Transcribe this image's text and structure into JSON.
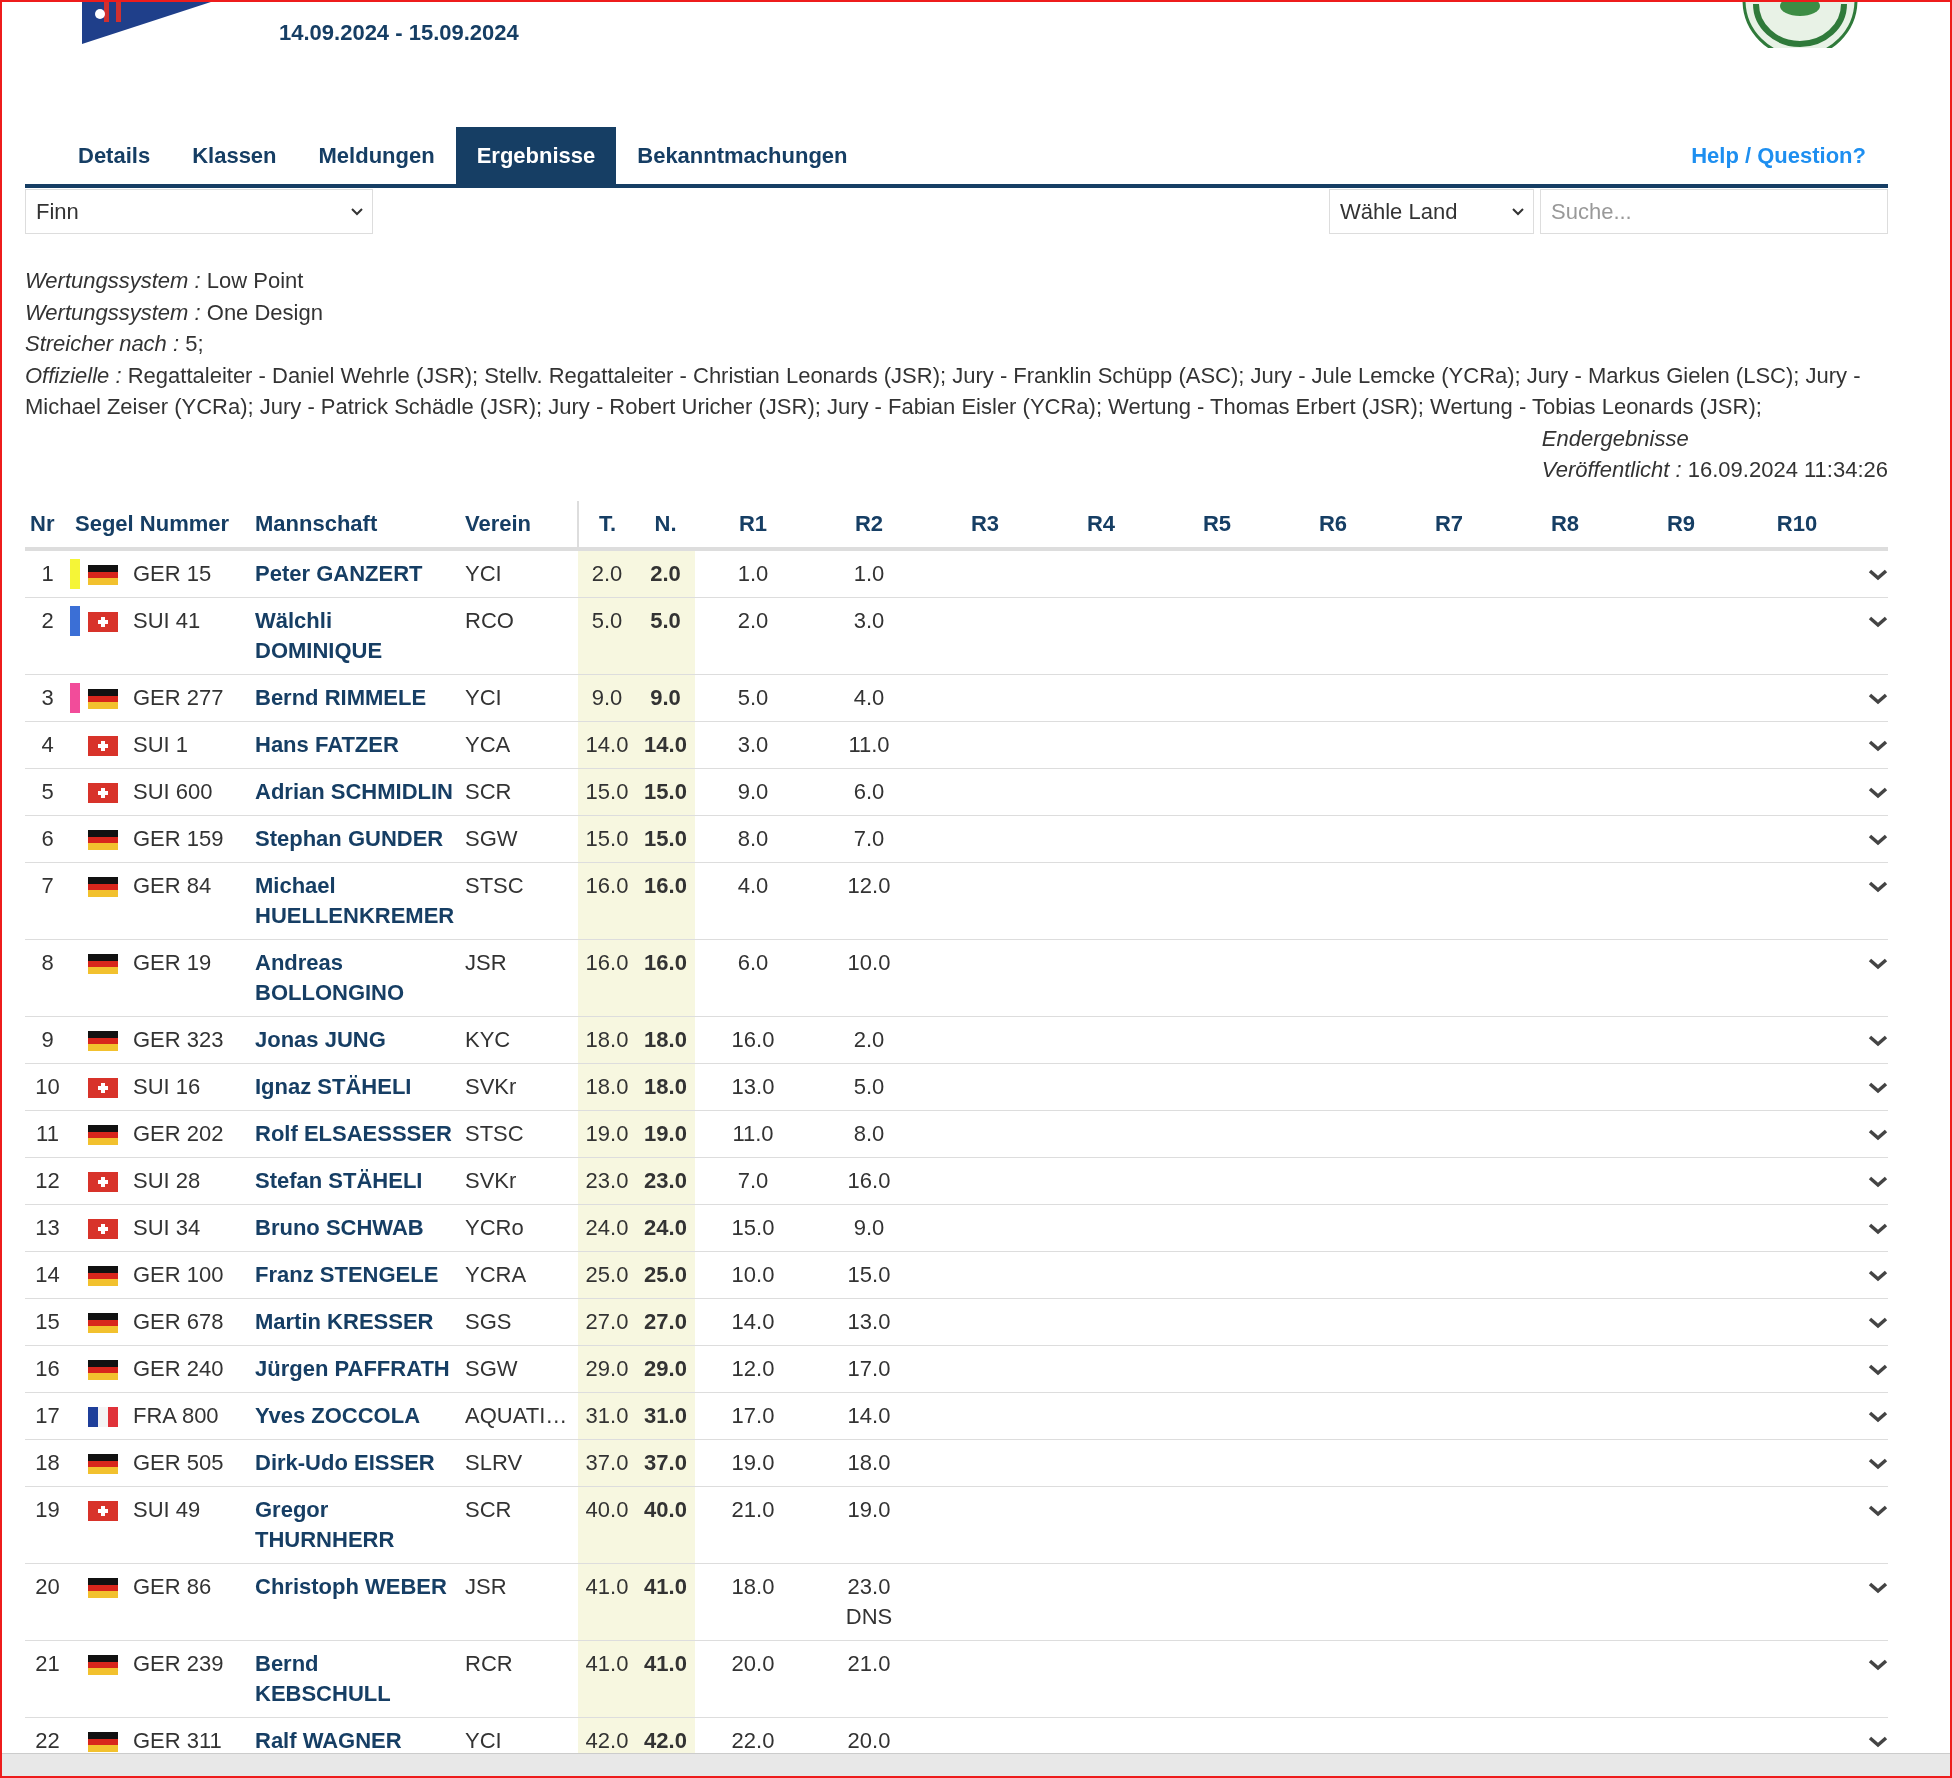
{
  "header": {
    "dates": "14.09.2024 - 15.09.2024"
  },
  "tabs": [
    {
      "label": "Details",
      "selected": false
    },
    {
      "label": "Klassen",
      "selected": false
    },
    {
      "label": "Meldungen",
      "selected": false
    },
    {
      "label": "Ergebnisse",
      "selected": true
    },
    {
      "label": "Bekanntmachungen",
      "selected": false
    }
  ],
  "help_link": "Help / Question?",
  "filters": {
    "class_select": "Finn",
    "country_select": "Wähle Land",
    "search": {
      "placeholder": "Suche..."
    }
  },
  "info": [
    "*Wertungssystem :* Low Point",
    "*Wertungssystem :* One Design",
    "*Streicher nach :* 5;",
    "*Offizielle :* Regattaleiter - Daniel Wehrle (JSR); Stellv. Regattaleiter - Christian Leonards (JSR); Jury - Franklin Schüpp (ASC); Jury - Jule Lemcke (YCRa); Jury - Markus Gielen (LSC); Jury - Michael Zeiser (YCRa); Jury - Patrick Schädle (JSR); Jury - Robert Uricher (JSR); Jury - Fabian Eisler (YCRa); Wertung - Thomas Erbert (JSR); Wertung - Tobias Leonards (JSR);"
  ],
  "status": {
    "label": "Endergebnisse",
    "published": "*Veröffentlicht :* 16.09.2024 11:34:26"
  },
  "table": {
    "columns": [
      "Nr",
      "Segel Nummer",
      "Mannschaft",
      "Verein",
      "T.",
      "N.",
      "R1",
      "R2",
      "R3",
      "R4",
      "R5",
      "R6",
      "R7",
      "R8",
      "R9",
      "R10"
    ],
    "rows": [
      {
        "nr": "1",
        "color": "#f5f537",
        "kind": "ger",
        "sail": "GER 15",
        "name": "Peter GANZERT",
        "club": "YCI",
        "total": "2.0",
        "net": "2.0",
        "races": [
          {
            "score": "1.0"
          },
          {
            "score": "1.0"
          }
        ]
      },
      {
        "nr": "2",
        "color": "#3b6fd6",
        "kind": "sui",
        "sail": "SUI 41",
        "name": "Wälchli DOMINIQUE",
        "club": "RCO",
        "total": "5.0",
        "net": "5.0",
        "races": [
          {
            "score": "2.0"
          },
          {
            "score": "3.0"
          }
        ]
      },
      {
        "nr": "3",
        "color": "#f24c9a",
        "kind": "ger",
        "sail": "GER 277",
        "name": "Bernd RIMMELE",
        "club": "YCI",
        "total": "9.0",
        "net": "9.0",
        "races": [
          {
            "score": "5.0"
          },
          {
            "score": "4.0"
          }
        ]
      },
      {
        "nr": "4",
        "kind": "sui",
        "sail": "SUI 1",
        "name": "Hans FATZER",
        "club": "YCA",
        "total": "14.0",
        "net": "14.0",
        "races": [
          {
            "score": "3.0"
          },
          {
            "score": "11.0"
          }
        ]
      },
      {
        "nr": "5",
        "kind": "sui",
        "sail": "SUI 600",
        "name": "Adrian SCHMIDLIN",
        "club": "SCR",
        "total": "15.0",
        "net": "15.0",
        "races": [
          {
            "score": "9.0"
          },
          {
            "score": "6.0"
          }
        ]
      },
      {
        "nr": "6",
        "kind": "ger",
        "sail": "GER 159",
        "name": "Stephan GUNDER",
        "club": "SGW",
        "total": "15.0",
        "net": "15.0",
        "races": [
          {
            "score": "8.0"
          },
          {
            "score": "7.0"
          }
        ]
      },
      {
        "nr": "7",
        "kind": "ger",
        "sail": "GER 84",
        "name": "Michael HUELLENKREMER",
        "club": "STSC",
        "total": "16.0",
        "net": "16.0",
        "races": [
          {
            "score": "4.0"
          },
          {
            "score": "12.0"
          }
        ]
      },
      {
        "nr": "8",
        "kind": "ger",
        "sail": "GER 19",
        "name": "Andreas BOLLONGINO",
        "club": "JSR",
        "total": "16.0",
        "net": "16.0",
        "races": [
          {
            "score": "6.0"
          },
          {
            "score": "10.0"
          }
        ]
      },
      {
        "nr": "9",
        "kind": "ger",
        "sail": "GER 323",
        "name": "Jonas JUNG",
        "club": "KYC",
        "total": "18.0",
        "net": "18.0",
        "races": [
          {
            "score": "16.0"
          },
          {
            "score": "2.0"
          }
        ]
      },
      {
        "nr": "10",
        "kind": "sui",
        "sail": "SUI 16",
        "name": "Ignaz STÄHELI",
        "club": "SVKr",
        "total": "18.0",
        "net": "18.0",
        "races": [
          {
            "score": "13.0"
          },
          {
            "score": "5.0"
          }
        ]
      },
      {
        "nr": "11",
        "kind": "ger",
        "sail": "GER 202",
        "name": "Rolf ELSAESSSER",
        "club": "STSC",
        "total": "19.0",
        "net": "19.0",
        "races": [
          {
            "score": "11.0"
          },
          {
            "score": "8.0"
          }
        ]
      },
      {
        "nr": "12",
        "kind": "sui",
        "sail": "SUI 28",
        "name": "Stefan STÄHELI",
        "club": "SVKr",
        "total": "23.0",
        "net": "23.0",
        "races": [
          {
            "score": "7.0"
          },
          {
            "score": "16.0"
          }
        ]
      },
      {
        "nr": "13",
        "kind": "sui",
        "sail": "SUI 34",
        "name": "Bruno SCHWAB",
        "club": "YCRo",
        "total": "24.0",
        "net": "24.0",
        "races": [
          {
            "score": "15.0"
          },
          {
            "score": "9.0"
          }
        ]
      },
      {
        "nr": "14",
        "kind": "ger",
        "sail": "GER 100",
        "name": "Franz STENGELE",
        "club": "YCRA",
        "total": "25.0",
        "net": "25.0",
        "races": [
          {
            "score": "10.0"
          },
          {
            "score": "15.0"
          }
        ]
      },
      {
        "nr": "15",
        "kind": "ger",
        "sail": "GER 678",
        "name": "Martin KRESSER",
        "club": "SGS",
        "total": "27.0",
        "net": "27.0",
        "races": [
          {
            "score": "14.0"
          },
          {
            "score": "13.0"
          }
        ]
      },
      {
        "nr": "16",
        "kind": "ger",
        "sail": "GER 240",
        "name": "Jürgen PAFFRATH",
        "club": "SGW",
        "total": "29.0",
        "net": "29.0",
        "races": [
          {
            "score": "12.0"
          },
          {
            "score": "17.0"
          }
        ]
      },
      {
        "nr": "17",
        "kind": "fra",
        "sail": "FRA 800",
        "name": "Yves ZOCCOLA",
        "club": "AQUATI…",
        "total": "31.0",
        "net": "31.0",
        "races": [
          {
            "score": "17.0"
          },
          {
            "score": "14.0"
          }
        ]
      },
      {
        "nr": "18",
        "kind": "ger",
        "sail": "GER 505",
        "name": "Dirk-Udo EISSER",
        "club": "SLRV",
        "total": "37.0",
        "net": "37.0",
        "races": [
          {
            "score": "19.0"
          },
          {
            "score": "18.0"
          }
        ]
      },
      {
        "nr": "19",
        "kind": "sui",
        "sail": "SUI 49",
        "name": "Gregor THURNHERR",
        "club": "SCR",
        "total": "40.0",
        "net": "40.0",
        "races": [
          {
            "score": "21.0"
          },
          {
            "score": "19.0"
          }
        ]
      },
      {
        "nr": "20",
        "kind": "ger",
        "sail": "GER 86",
        "name": "Christoph WEBER",
        "club": "JSR",
        "total": "41.0",
        "net": "41.0",
        "races": [
          {
            "score": "18.0"
          },
          {
            "score": "23.0",
            "code": "DNS"
          }
        ]
      },
      {
        "nr": "21",
        "kind": "ger",
        "sail": "GER 239",
        "name": "Bernd KEBSCHULL",
        "club": "RCR",
        "total": "41.0",
        "net": "41.0",
        "races": [
          {
            "score": "20.0"
          },
          {
            "score": "21.0"
          }
        ]
      },
      {
        "nr": "22",
        "kind": "ger",
        "sail": "GER 311",
        "name": "Ralf WAGNER",
        "club": "YCI",
        "total": "42.0",
        "net": "42.0",
        "races": [
          {
            "score": "22.0"
          },
          {
            "score": "20.0"
          }
        ]
      }
    ]
  }
}
